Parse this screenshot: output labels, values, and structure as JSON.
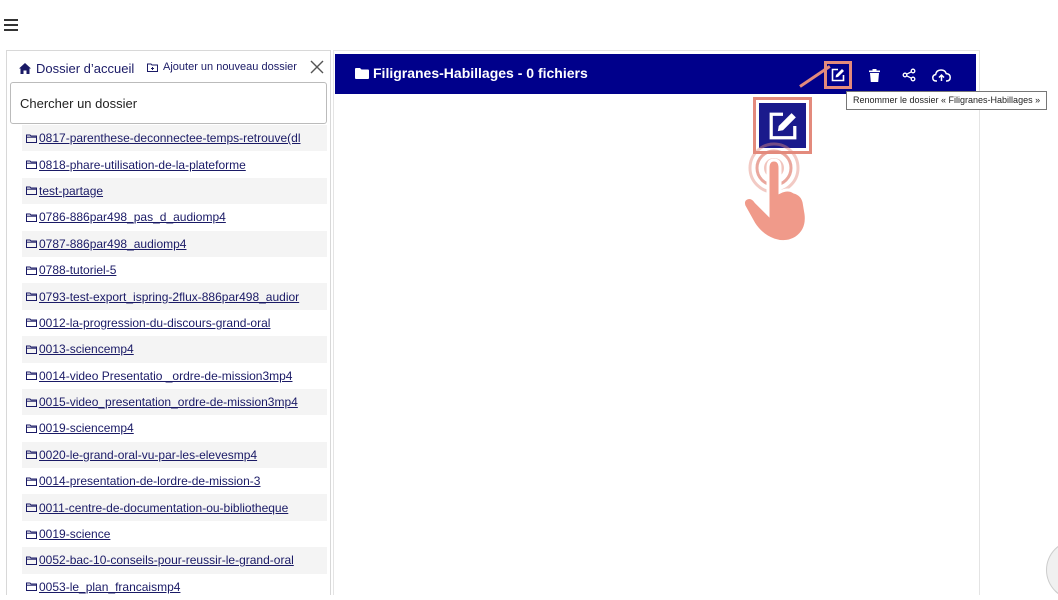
{
  "nav": {
    "menu_icon": "hamburger-icon"
  },
  "sidebar": {
    "home_label": "Dossier d’accueil",
    "add_label": "Ajouter un nouveau dossier",
    "search_placeholder": "Chercher un dossier",
    "folders": [
      "0817-parenthese-deconnectee-temps-retrouve(dl",
      "0818-phare-utilisation-de-la-plateforme",
      "test-partage",
      "0786-886par498_pas_d_audiomp4",
      "0787-886par498_audiomp4",
      "0788-tutoriel-5",
      "0793-test-export_ispring-2flux-886par498_audior",
      "0012-la-progression-du-discours-grand-oral",
      "0013-sciencemp4",
      "0014-video Presentatio _ordre-de-mission3mp4",
      "0015-video_presentation_ordre-de-mission3mp4",
      "0019-sciencemp4",
      "0020-le-grand-oral-vu-par-les-elevesmp4",
      "0014-presentation-de-lordre-de-mission-3",
      "0011-centre-de-documentation-ou-bibliotheque",
      "0019-science",
      "0052-bac-10-conseils-pour-reussir-le-grand-oral",
      "0053-le_plan_francaismp4"
    ]
  },
  "main": {
    "title": "Filigranes-Habillages - 0 fichiers",
    "toolbar_icons": [
      "edit-icon",
      "trash-icon",
      "share-icon",
      "cloud-upload-icon"
    ],
    "tooltip": "Renommer le dossier « Filigranes-Habillages »"
  },
  "colors": {
    "header_bg": "#00008b",
    "highlight": "#e38a7c",
    "link": "#1a1a66"
  }
}
